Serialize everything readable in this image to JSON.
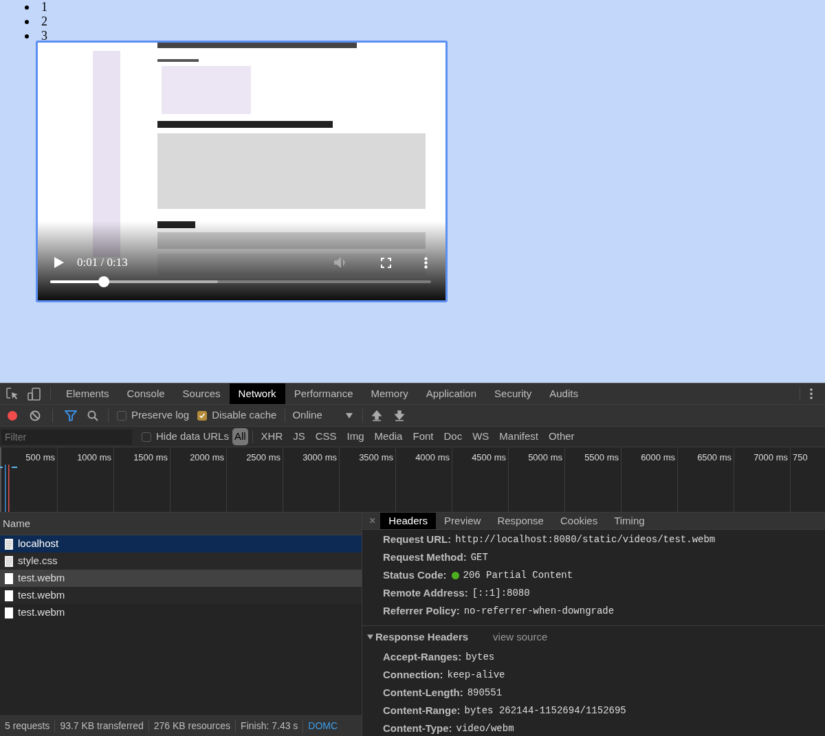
{
  "page_list": [
    "1",
    "2",
    "3"
  ],
  "video": {
    "focused": true,
    "time": "0:01 / 0:13",
    "progress": {
      "level": 0.14
    },
    "buffer": {
      "level": 0.44
    }
  },
  "devtools": {
    "panel_tabs": [
      {
        "label": "Elements",
        "selected": false
      },
      {
        "label": "Console",
        "selected": false
      },
      {
        "label": "Sources",
        "selected": false
      },
      {
        "label": "Network",
        "selected": true
      },
      {
        "label": "Performance",
        "selected": false
      },
      {
        "label": "Memory",
        "selected": false
      },
      {
        "label": "Application",
        "selected": false
      },
      {
        "label": "Security",
        "selected": false
      },
      {
        "label": "Audits",
        "selected": false
      }
    ],
    "toolbar": {
      "recording": true,
      "filter_active": true,
      "preserve_log": {
        "label": "Preserve log",
        "checked": false
      },
      "disable_cache": {
        "label": "Disable cache",
        "checked": true
      },
      "throttling": "Online"
    },
    "filter_bar": {
      "placeholder": "Filter",
      "hide_data_urls": {
        "label": "Hide data URLs",
        "checked": false
      },
      "types": [
        {
          "label": "All",
          "selected": true
        },
        {
          "label": "XHR",
          "selected": false
        },
        {
          "label": "JS",
          "selected": false
        },
        {
          "label": "CSS",
          "selected": false
        },
        {
          "label": "Img",
          "selected": false
        },
        {
          "label": "Media",
          "selected": false
        },
        {
          "label": "Font",
          "selected": false
        },
        {
          "label": "Doc",
          "selected": false
        },
        {
          "label": "WS",
          "selected": false
        },
        {
          "label": "Manifest",
          "selected": false
        },
        {
          "label": "Other",
          "selected": false
        }
      ]
    },
    "timeline": {
      "ticks": [
        "500 ms",
        "1000 ms",
        "1500 ms",
        "2000 ms",
        "2500 ms",
        "3000 ms",
        "3500 ms",
        "4000 ms",
        "4500 ms",
        "5000 ms",
        "5500 ms",
        "6000 ms",
        "6500 ms",
        "7000 ms",
        "750"
      ]
    },
    "requests": {
      "column": "Name",
      "rows": [
        {
          "name": "localhost",
          "kind": "document",
          "selected": true,
          "hovered": false
        },
        {
          "name": "style.css",
          "kind": "document",
          "selected": false,
          "hovered": false
        },
        {
          "name": "test.webm",
          "kind": "media",
          "selected": false,
          "hovered": true
        },
        {
          "name": "test.webm",
          "kind": "media",
          "selected": false,
          "hovered": false
        },
        {
          "name": "test.webm",
          "kind": "media",
          "selected": false,
          "hovered": false
        }
      ]
    },
    "details": {
      "close": "×",
      "tabs": [
        {
          "label": "Headers",
          "selected": true
        },
        {
          "label": "Preview",
          "selected": false
        },
        {
          "label": "Response",
          "selected": false
        },
        {
          "label": "Cookies",
          "selected": false
        },
        {
          "label": "Timing",
          "selected": false
        }
      ],
      "general": [
        {
          "label": "Request URL:",
          "value": "http://localhost:8080/static/videos/test.webm"
        },
        {
          "label": "Request Method:",
          "value": "GET"
        },
        {
          "label": "Status Code:",
          "value": "206 Partial Content",
          "color": "#4caf20"
        },
        {
          "label": "Remote Address:",
          "value": "[::1]:8080"
        },
        {
          "label": "Referrer Policy:",
          "value": "no-referrer-when-downgrade"
        }
      ],
      "response_headers": {
        "title": "Response Headers",
        "expanded": true,
        "view_source": "view source",
        "rows": [
          {
            "label": "Accept-Ranges:",
            "value": "bytes"
          },
          {
            "label": "Connection:",
            "value": "keep-alive"
          },
          {
            "label": "Content-Length:",
            "value": "890551"
          },
          {
            "label": "Content-Range:",
            "value": "bytes 262144-1152694/1152695"
          },
          {
            "label": "Content-Type:",
            "value": "video/webm"
          }
        ]
      }
    },
    "summary": [
      "5 requests",
      "93.7 KB transferred",
      "276 KB resources",
      "Finish: 7.43 s",
      "DOMC"
    ]
  }
}
